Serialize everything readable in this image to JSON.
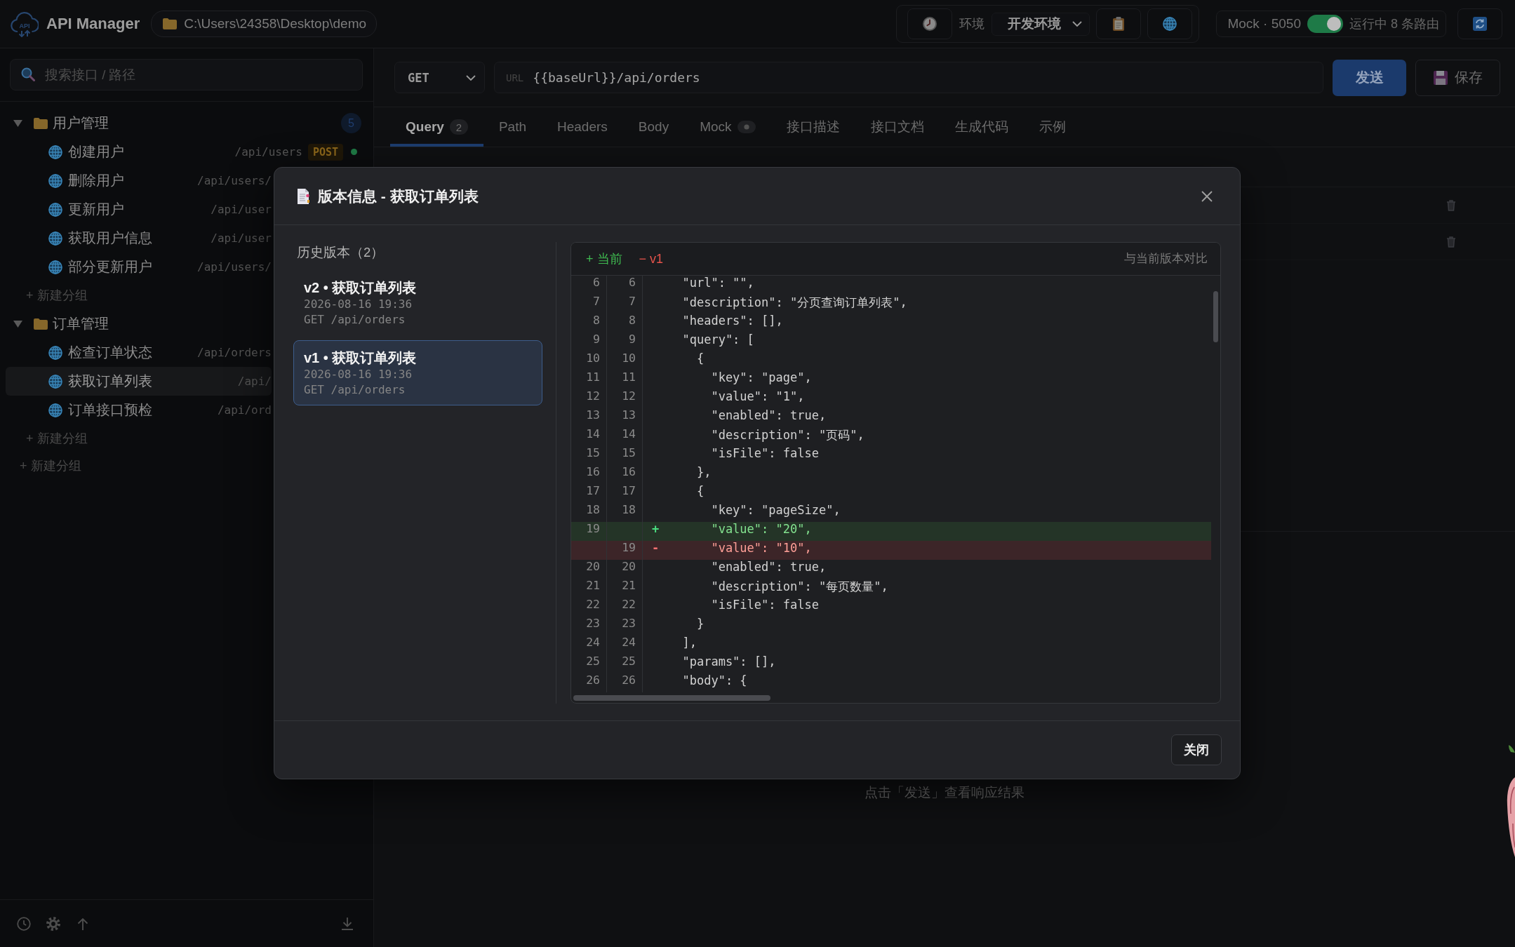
{
  "app": {
    "logo_text": "API",
    "title": "API Manager",
    "workspace_path": "C:\\Users\\24358\\Desktop\\demo"
  },
  "toolbar": {
    "environment_label": "环境",
    "environment": "开发环境",
    "mock": {
      "label": "Mock · 5050",
      "on": true,
      "status": "运行中 8 条路由"
    }
  },
  "sidebar": {
    "search": {
      "placeholder": "搜索接口 / 路径"
    },
    "groups": [
      {
        "name": "用户管理",
        "expanded": true,
        "count": "5",
        "items": [
          {
            "name": "创建用户",
            "path": "/api/users",
            "method": "POST",
            "color": "#1f7a45",
            "selected": false
          },
          {
            "name": "删除用户",
            "path": "/api/users/",
            "selected": false
          },
          {
            "name": "更新用户",
            "path": "/api/user",
            "selected": false
          },
          {
            "name": "获取用户信息",
            "path": "/api/user",
            "selected": false
          },
          {
            "name": "部分更新用户",
            "path": "/api/users/",
            "selected": false
          }
        ],
        "add_label": "+ 新建分组"
      },
      {
        "name": "订单管理",
        "expanded": true,
        "items": [
          {
            "name": "检查订单状态",
            "path": "/api/orders",
            "selected": false
          },
          {
            "name": "获取订单列表",
            "path": "/api/",
            "selected": true
          },
          {
            "name": "订单接口预检",
            "path": "/api/ord",
            "selected": false
          }
        ],
        "add_label": "+ 新建分组"
      }
    ],
    "add_group": "+ 新建分组"
  },
  "request": {
    "method": "GET",
    "url_label": "URL",
    "url": "{{baseUrl}}/api/orders",
    "send": "发送",
    "save": "保存"
  },
  "tabs": [
    {
      "label": "Query",
      "badge": "2",
      "indicator": false,
      "selected": true
    },
    {
      "label": "Path",
      "indicator": false,
      "selected": false
    },
    {
      "label": "Headers",
      "indicator": false,
      "selected": false
    },
    {
      "label": "Body",
      "indicator": false,
      "selected": false
    },
    {
      "label": "Mock",
      "indicator": true,
      "selected": false
    },
    {
      "label": "接口描述",
      "indicator": false,
      "selected": false
    },
    {
      "label": "接口文档",
      "indicator": false,
      "selected": false
    },
    {
      "label": "生成代码",
      "indicator": false,
      "selected": false
    },
    {
      "label": "示例",
      "indicator": false,
      "selected": false
    }
  ],
  "response": {
    "hint": "点击「发送」查看响应结果"
  },
  "modal": {
    "title": "版本信息 - 获取订单列表",
    "history_heading": "历史版本（2）",
    "versions": [
      {
        "title": "v2 • 获取订单列表",
        "date": "2026-08-16 19:36",
        "request": "GET /api/orders",
        "selected": false
      },
      {
        "title": "v1 • 获取订单列表",
        "date": "2026-08-16 19:36",
        "request": "GET /api/orders",
        "selected": true
      }
    ],
    "diff": {
      "legend": [
        {
          "kind": "added",
          "label": "+ 当前"
        },
        {
          "kind": "removed",
          "label": "− v1"
        }
      ],
      "compare_label": "与当前版本对比",
      "lines": [
        {
          "kind": "context",
          "old": "6",
          "new": "6",
          "code": "  \"url\": \"\","
        },
        {
          "kind": "context",
          "old": "7",
          "new": "7",
          "code": "  \"description\": \"分页查询订单列表\","
        },
        {
          "kind": "context",
          "old": "8",
          "new": "8",
          "code": "  \"headers\": [],"
        },
        {
          "kind": "context",
          "old": "9",
          "new": "9",
          "code": "  \"query\": ["
        },
        {
          "kind": "context",
          "old": "10",
          "new": "10",
          "code": "    {"
        },
        {
          "kind": "context",
          "old": "11",
          "new": "11",
          "code": "      \"key\": \"page\","
        },
        {
          "kind": "context",
          "old": "12",
          "new": "12",
          "code": "      \"value\": \"1\","
        },
        {
          "kind": "context",
          "old": "13",
          "new": "13",
          "code": "      \"enabled\": true,"
        },
        {
          "kind": "context",
          "old": "14",
          "new": "14",
          "code": "      \"description\": \"页码\","
        },
        {
          "kind": "context",
          "old": "15",
          "new": "15",
          "code": "      \"isFile\": false"
        },
        {
          "kind": "context",
          "old": "16",
          "new": "16",
          "code": "    },"
        },
        {
          "kind": "context",
          "old": "17",
          "new": "17",
          "code": "    {"
        },
        {
          "kind": "context",
          "old": "18",
          "new": "18",
          "code": "      \"key\": \"pageSize\","
        },
        {
          "kind": "added",
          "old": "19",
          "marker": "+",
          "code": "      \"value\": \"20\","
        },
        {
          "kind": "removed",
          "new": "19",
          "marker": "-",
          "code": "      \"value\": \"10\","
        },
        {
          "kind": "context",
          "old": "20",
          "new": "20",
          "code": "      \"enabled\": true,"
        },
        {
          "kind": "context",
          "old": "21",
          "new": "21",
          "code": "      \"description\": \"每页数量\","
        },
        {
          "kind": "context",
          "old": "22",
          "new": "22",
          "code": "      \"isFile\": false"
        },
        {
          "kind": "context",
          "old": "23",
          "new": "23",
          "code": "    }"
        },
        {
          "kind": "context",
          "old": "24",
          "new": "24",
          "code": "  ],"
        },
        {
          "kind": "context",
          "old": "25",
          "new": "25",
          "code": "  \"params\": [],"
        },
        {
          "kind": "context",
          "old": "26",
          "new": "26",
          "code": "  \"body\": {"
        }
      ]
    },
    "close": "关闭"
  }
}
